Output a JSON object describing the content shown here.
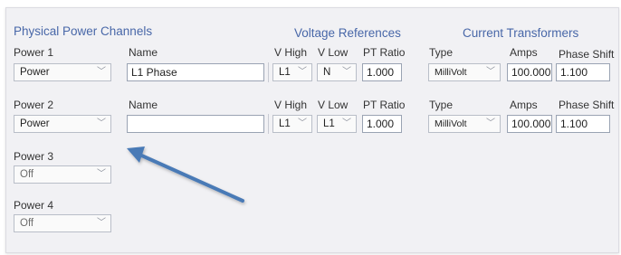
{
  "physical_power": {
    "title": "Physical Power Channels",
    "power1": {
      "label": "Power 1",
      "type_value": "Power",
      "name_label": "Name",
      "name_value": "L1 Phase",
      "v_high_label": "V High",
      "v_high_value": "L1",
      "v_low_label": "V Low",
      "v_low_value": "N",
      "pt_ratio_label": "PT Ratio",
      "pt_ratio_value": "1.000",
      "ct_type_label": "Type",
      "ct_type_value": "MilliVolt",
      "amps_label": "Amps",
      "amps_value": "100.000",
      "phase_shift_label": "Phase Shift",
      "phase_shift_value": "1.100"
    },
    "power2": {
      "label": "Power 2",
      "type_value": "Power",
      "name_label": "Name",
      "name_value": "",
      "v_high_label": "V High",
      "v_high_value": "L1",
      "v_low_label": "V Low",
      "v_low_value": "L1",
      "pt_ratio_label": "PT Ratio",
      "pt_ratio_value": "1.000",
      "ct_type_label": "Type",
      "ct_type_value": "MilliVolt",
      "amps_label": "Amps",
      "amps_value": "100.000",
      "phase_shift_label": "Phase Shift",
      "phase_shift_value": "1.100"
    },
    "power3": {
      "label": "Power 3",
      "type_value": "Off"
    },
    "power4": {
      "label": "Power 4",
      "type_value": "Off"
    }
  },
  "voltage_references": {
    "title": "Voltage References"
  },
  "current_transformers": {
    "title": "Current Transformers"
  },
  "annotation": {
    "arrow_color": "#4a7ab6"
  }
}
